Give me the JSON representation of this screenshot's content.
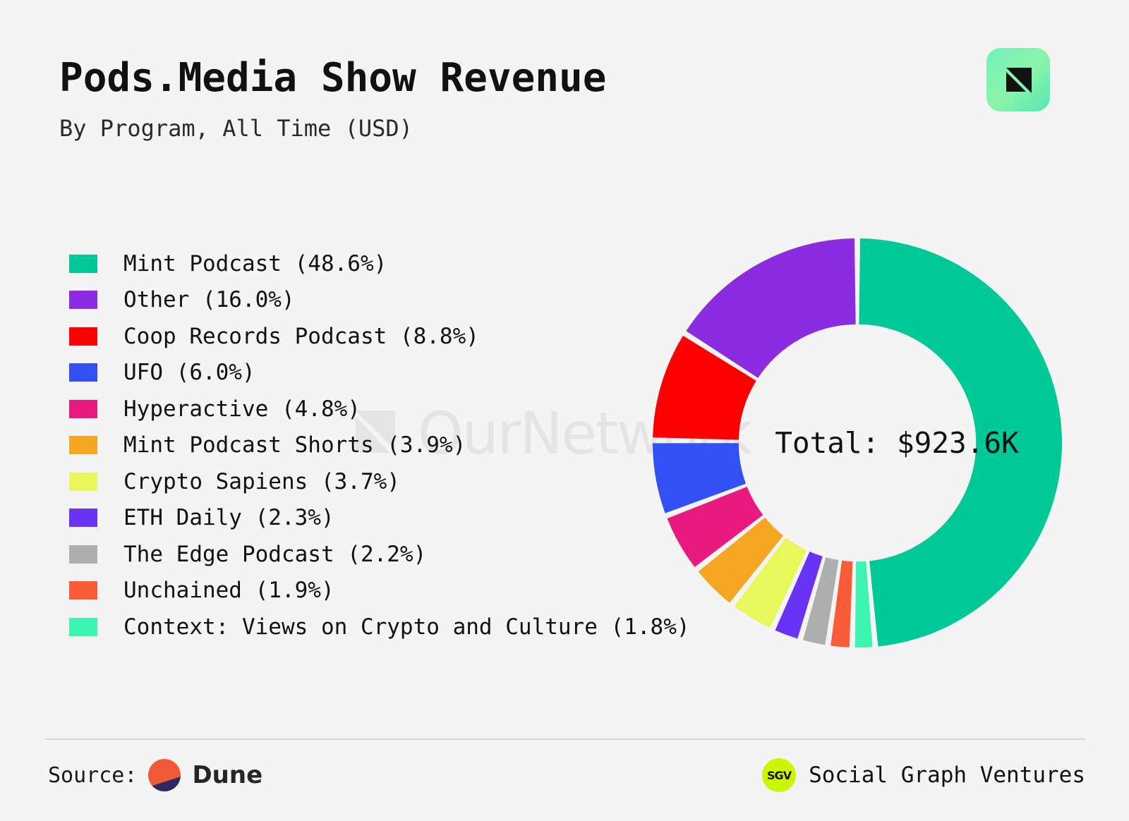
{
  "header": {
    "title": "Pods.Media Show Revenue",
    "subtitle": "By Program, All Time (USD)"
  },
  "brand_badge": {
    "icon": "ournetwork-logo-icon",
    "gradient_from": "#6ff0c0",
    "gradient_to": "#56e8b4",
    "mark_color": "#121212"
  },
  "watermark": {
    "text": "OurNetwork",
    "color": "#e4e4e4"
  },
  "donut": {
    "center_total_label": "Total: $923.6K"
  },
  "footer": {
    "source_label": "Source:",
    "source_name": "Dune",
    "source_logo_icon": "dune-logo-icon",
    "source_logo_colors": {
      "top": "#f05a37",
      "bottom": "#2b2a63"
    },
    "partner_name": "Social Graph Ventures",
    "partner_logo_icon": "sgv-logo-icon",
    "partner_logo_text": "SGV",
    "partner_logo_color": "#ccf500"
  },
  "chart_data": {
    "type": "pie",
    "title": "Pods.Media Show Revenue",
    "subtitle": "By Program, All Time (USD)",
    "units": "USD",
    "total_label": "Total: $923.6K",
    "total_value": 923600,
    "donut": true,
    "inner_radius_ratio": 0.58,
    "legend_position": "left",
    "start_angle_deg": 0,
    "direction": "both-from-top",
    "labels": [
      "Mint Podcast",
      "Other",
      "Coop Records Podcast",
      "UFO",
      "Hyperactive",
      "Mint Podcast Shorts",
      "Crypto Sapiens",
      "ETH Daily",
      "The Edge Podcast",
      "Unchained",
      "Context: Views on Crypto and Culture"
    ],
    "values": [
      48.6,
      16.0,
      8.8,
      6.0,
      4.8,
      3.9,
      3.7,
      2.3,
      2.2,
      1.9,
      1.8
    ],
    "colors": [
      "#00c896",
      "#8b2be2",
      "#ff0000",
      "#3350f5",
      "#e8197f",
      "#f5a623",
      "#e9f75a",
      "#6933f5",
      "#aeaeae",
      "#f95a37",
      "#3df5b0"
    ],
    "legend_entries": [
      {
        "label": "Mint Podcast (48.6%)",
        "color": "#00c896"
      },
      {
        "label": "Other (16.0%)",
        "color": "#8b2be2"
      },
      {
        "label": "Coop Records Podcast (8.8%)",
        "color": "#ff0000"
      },
      {
        "label": "UFO (6.0%)",
        "color": "#3350f5"
      },
      {
        "label": "Hyperactive (4.8%)",
        "color": "#e8197f"
      },
      {
        "label": "Mint Podcast Shorts (3.9%)",
        "color": "#f5a623"
      },
      {
        "label": "Crypto Sapiens (3.7%)",
        "color": "#e9f75a"
      },
      {
        "label": "ETH Daily (2.3%)",
        "color": "#6933f5"
      },
      {
        "label": "The Edge Podcast (2.2%)",
        "color": "#aeaeae"
      },
      {
        "label": "Unchained (1.9%)",
        "color": "#f95a37"
      },
      {
        "label": "Context: Views on Crypto and Culture (1.8%)",
        "color": "#3df5b0"
      }
    ]
  }
}
